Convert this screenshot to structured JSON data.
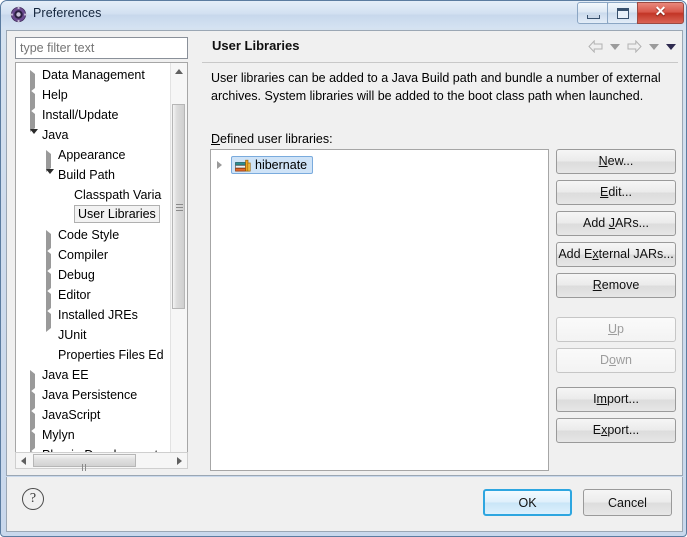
{
  "window": {
    "title": "Preferences",
    "icon": "preferences-gear-icon",
    "controls": {
      "minimize": "minimize-icon",
      "maximize": "maximize-icon",
      "close": "✕"
    }
  },
  "sidebar": {
    "filter": {
      "placeholder": "type filter text",
      "value": ""
    },
    "tree": [
      {
        "label": "Data Management",
        "indent": 0,
        "state": "collapsed"
      },
      {
        "label": "Help",
        "indent": 0,
        "state": "collapsed"
      },
      {
        "label": "Install/Update",
        "indent": 0,
        "state": "collapsed"
      },
      {
        "label": "Java",
        "indent": 0,
        "state": "expanded"
      },
      {
        "label": "Appearance",
        "indent": 1,
        "state": "collapsed"
      },
      {
        "label": "Build Path",
        "indent": 1,
        "state": "expanded"
      },
      {
        "label": "Classpath Varia",
        "indent": 2,
        "state": "leaf"
      },
      {
        "label": "User Libraries",
        "indent": 2,
        "state": "leaf",
        "selected": true
      },
      {
        "label": "Code Style",
        "indent": 1,
        "state": "collapsed"
      },
      {
        "label": "Compiler",
        "indent": 1,
        "state": "collapsed"
      },
      {
        "label": "Debug",
        "indent": 1,
        "state": "collapsed"
      },
      {
        "label": "Editor",
        "indent": 1,
        "state": "collapsed"
      },
      {
        "label": "Installed JREs",
        "indent": 1,
        "state": "collapsed"
      },
      {
        "label": "JUnit",
        "indent": 1,
        "state": "leaf"
      },
      {
        "label": "Properties Files Ed",
        "indent": 1,
        "state": "leaf"
      },
      {
        "label": "Java EE",
        "indent": 0,
        "state": "collapsed"
      },
      {
        "label": "Java Persistence",
        "indent": 0,
        "state": "collapsed"
      },
      {
        "label": "JavaScript",
        "indent": 0,
        "state": "collapsed"
      },
      {
        "label": "Mylyn",
        "indent": 0,
        "state": "collapsed"
      },
      {
        "label": "Plug-in Development",
        "indent": 0,
        "state": "collapsed"
      }
    ]
  },
  "page": {
    "title": "User Libraries",
    "nav": {
      "back": "back-arrow-icon",
      "back_menu": "chevron-down-icon",
      "forward": "forward-arrow-icon",
      "forward_menu": "chevron-down-icon",
      "page_menu": "chevron-down-icon"
    },
    "description": "User libraries can be added to a Java Build path and bundle a number of external archives. System libraries will be added to the boot class path when launched.",
    "list_label_mnemonic": "D",
    "list_label_rest": "efined user libraries:",
    "libraries": [
      {
        "name": "hibernate",
        "icon": "library-books-icon",
        "selected": true,
        "expandable": true
      }
    ],
    "buttons": [
      {
        "pre": "",
        "mnemonic": "N",
        "post": "ew...",
        "enabled": true
      },
      {
        "pre": "",
        "mnemonic": "E",
        "post": "dit...",
        "enabled": true
      },
      {
        "pre": "Add ",
        "mnemonic": "J",
        "post": "ARs...",
        "enabled": true
      },
      {
        "pre": "Add E",
        "mnemonic": "x",
        "post": "ternal JARs...",
        "enabled": true
      },
      {
        "pre": "",
        "mnemonic": "R",
        "post": "emove",
        "enabled": true
      },
      {
        "pre": "",
        "mnemonic": "U",
        "post": "p",
        "enabled": false
      },
      {
        "pre": "D",
        "mnemonic": "o",
        "post": "wn",
        "enabled": false
      },
      {
        "pre": "I",
        "mnemonic": "m",
        "post": "port...",
        "enabled": true
      },
      {
        "pre": "E",
        "mnemonic": "x",
        "post": "port...",
        "enabled": true
      }
    ]
  },
  "footer": {
    "help": "?",
    "ok": "OK",
    "cancel": "Cancel"
  },
  "colors": {
    "selection_fill": "#cfe3f7",
    "selection_border": "#7aabdd",
    "focus_blue": "#2ea6e0",
    "close_red": "#c23526",
    "title_gradient_top": "#e4eef8",
    "panel_bg": "#f0f0f0"
  }
}
